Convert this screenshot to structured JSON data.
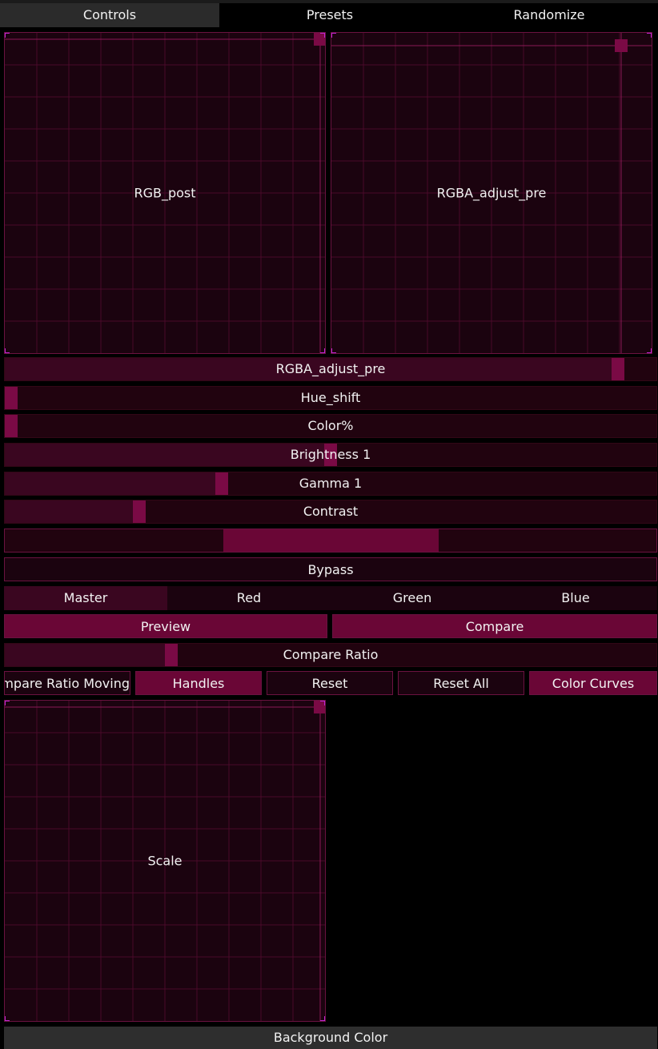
{
  "tabs": [
    {
      "label": "Controls",
      "active": true
    },
    {
      "label": "Presets",
      "active": false
    },
    {
      "label": "Randomize",
      "active": false
    }
  ],
  "pads": {
    "rgb_post": {
      "label": "RGB_post"
    },
    "rgba_adjust_pre": {
      "label": "RGBA_adjust_pre"
    },
    "scale": {
      "label": "Scale"
    }
  },
  "sliders": [
    {
      "label": "RGBA_adjust_pre",
      "value": 0.95
    },
    {
      "label": "Hue_shift",
      "value": 0.0
    },
    {
      "label": "Color%",
      "value": 0.0
    },
    {
      "label": "Brightness 1",
      "value": 0.5
    },
    {
      "label": "Gamma 1",
      "value": 0.33
    },
    {
      "label": "Contrast",
      "value": 0.2
    }
  ],
  "range": {
    "low": 0.335,
    "high": 0.665
  },
  "bypass_label": "Bypass",
  "channels": [
    {
      "label": "Master",
      "active": true
    },
    {
      "label": "Red",
      "active": false
    },
    {
      "label": "Green",
      "active": false
    },
    {
      "label": "Blue",
      "active": false
    }
  ],
  "preview_label": "Preview",
  "compare_label": "Compare",
  "compare_ratio": {
    "label": "Compare Ratio",
    "value": 0.25
  },
  "buttons": {
    "compare_ratio_moving": "Compare Ratio Moving",
    "handles": "Handles",
    "reset": "Reset",
    "reset_all": "Reset All",
    "color_curves": "Color Curves"
  },
  "background_color_label": "Background Color",
  "colors": {
    "accent": "#7a0a45",
    "grid": "#5a0e33",
    "border": "#6a1240"
  }
}
